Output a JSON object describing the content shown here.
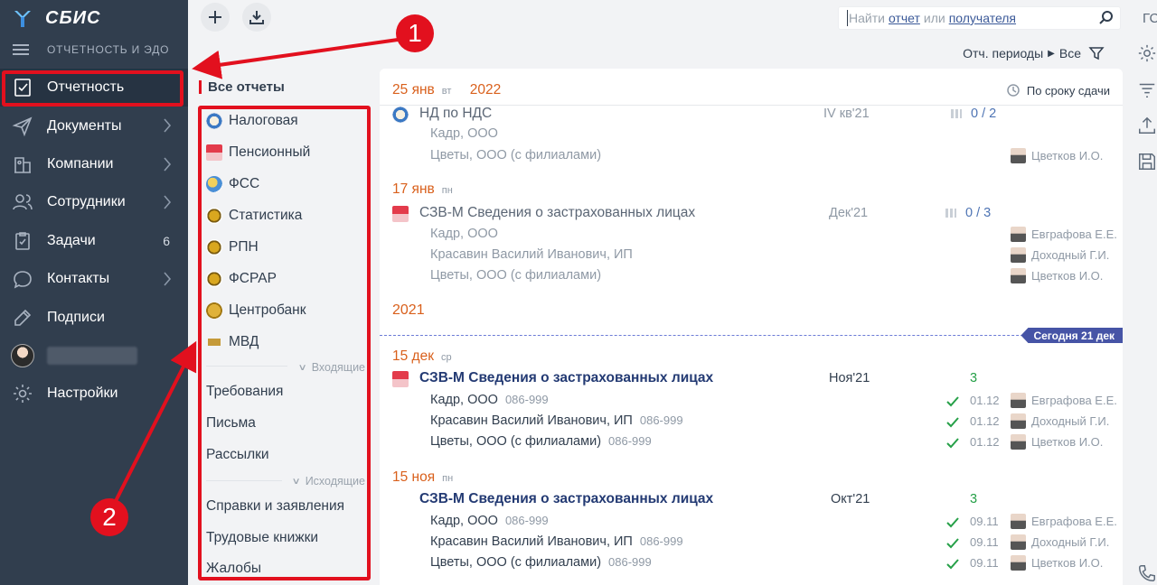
{
  "app": {
    "name": "СБИС",
    "section": "ОТЧЕТНОСТЬ И ЭДО"
  },
  "sidebar": {
    "items": [
      {
        "label": "Отчетность",
        "icon": "report-icon",
        "active": true
      },
      {
        "label": "Документы",
        "icon": "send-icon",
        "chevron": true
      },
      {
        "label": "Компании",
        "icon": "company-icon",
        "chevron": true
      },
      {
        "label": "Сотрудники",
        "icon": "employees-icon",
        "chevron": true
      },
      {
        "label": "Задачи",
        "icon": "tasks-icon",
        "count": "6"
      },
      {
        "label": "Контакты",
        "icon": "chat-icon",
        "chevron": true
      },
      {
        "label": "Подписи",
        "icon": "signature-icon"
      },
      {
        "label": "",
        "icon": "user-avatar"
      },
      {
        "label": "Настройки",
        "icon": "gear-icon"
      }
    ]
  },
  "toolbar": {
    "search": {
      "prefix": "Найти",
      "link1": "отчет",
      "middle": "или",
      "link2": "получателя"
    },
    "periods_label": "Отч. периоды",
    "periods_value": "Все"
  },
  "filters": {
    "header": "Все отчеты",
    "agencies": [
      "Налоговая",
      "Пенсионный",
      "ФСС",
      "Статистика",
      "РПН",
      "ФСРАР",
      "Центробанк",
      "МВД"
    ],
    "incoming_label": "Входящие",
    "incoming": [
      "Требования",
      "Письма",
      "Рассылки"
    ],
    "outgoing_label": "Исходящие",
    "outgoing": [
      "Справки и заявления",
      "Трудовые книжки",
      "Жалобы"
    ]
  },
  "main": {
    "head": {
      "day": "25",
      "month": "янв",
      "weekday": "вт",
      "year": "2022",
      "sort_label": "По сроку сдачи"
    },
    "groups": [
      {
        "title": "НД по НДС",
        "period": "IV кв'21",
        "progress": "0 / 2",
        "orgs": [
          {
            "name": "Кадр, ООО",
            "person": ""
          },
          {
            "name": "Цветы, ООО (с филиалами)",
            "person": "Цветков И.О."
          }
        ]
      },
      {
        "date": "17 янв",
        "weekday": "пн",
        "title": "СЗВ-М Сведения о застрахованных лицах",
        "period": "Дек'21",
        "progress": "0 / 3",
        "orgs": [
          {
            "name": "Кадр, ООО",
            "person": "Евграфова Е.Е."
          },
          {
            "name": "Красавин Василий Иванович, ИП",
            "person": "Доходный Г.И."
          },
          {
            "name": "Цветы, ООО (с филиалами)",
            "person": "Цветков И.О."
          }
        ]
      },
      {
        "date": "15 дек",
        "weekday": "ср",
        "title": "СЗВ-М Сведения о застрахованных лицах",
        "period": "Ноя'21",
        "count": "3",
        "orgs": [
          {
            "name": "Кадр, ООО",
            "code": "086-999",
            "sent": "01.12",
            "person": "Евграфова Е.Е."
          },
          {
            "name": "Красавин Василий Иванович, ИП",
            "code": "086-999",
            "sent": "01.12",
            "person": "Доходный Г.И."
          },
          {
            "name": "Цветы, ООО (с филиалами)",
            "code": "086-999",
            "sent": "01.12",
            "person": "Цветков И.О."
          }
        ]
      },
      {
        "date": "15 ноя",
        "weekday": "пн",
        "title": "СЗВ-М Сведения о застрахованных лицах",
        "period": "Окт'21",
        "count": "3",
        "orgs": [
          {
            "name": "Кадр, ООО",
            "code": "086-999",
            "sent": "09.11",
            "person": "Евграфова Е.Е."
          },
          {
            "name": "Красавин Василий Иванович, ИП",
            "code": "086-999",
            "sent": "09.11",
            "person": "Доходный Г.И."
          },
          {
            "name": "Цветы, ООО (с филиалами)",
            "code": "086-999",
            "sent": "09.11",
            "person": "Цветков И.О."
          }
        ]
      }
    ],
    "year_divider": "2021",
    "today_badge": "Сегодня 21 дек"
  },
  "annotations": {
    "one": "1",
    "two": "2"
  },
  "right_bar": {
    "top_text": "ГС"
  },
  "colors": {
    "sidebar": "#313e4e",
    "accent": "#e2101e",
    "date": "#d9601c",
    "link": "#233a73",
    "success": "#26a048"
  }
}
